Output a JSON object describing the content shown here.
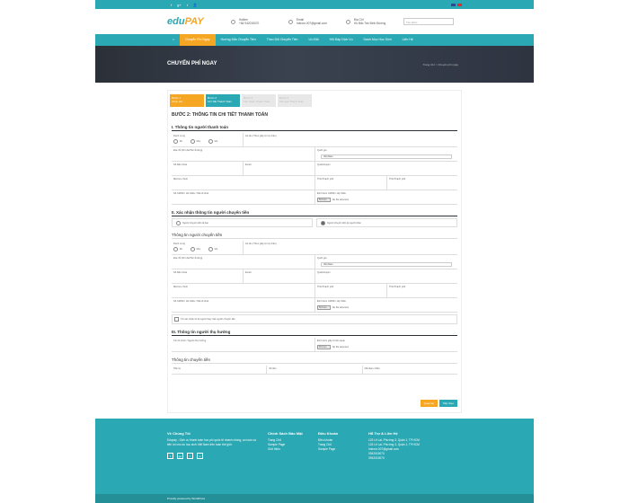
{
  "topbar": {
    "social": [
      "f",
      "g+",
      "t",
      "👤"
    ]
  },
  "header": {
    "logo_main": "edu",
    "logo_accent": "PAY",
    "items": [
      {
        "label": "Hotline",
        "value": "+84 942015070"
      },
      {
        "label": "Email",
        "value": "hotrom.007@gmail.com"
      },
      {
        "label": "Địa Chỉ",
        "value": "Hồ Bắc Tân Bình Đường"
      }
    ],
    "search_placeholder": "Tìm kiếm"
  },
  "nav": {
    "items": [
      "Chuyển Phí Ngay",
      "Hướng Dẫn Chuyển Tiền",
      "Theo Dõi Chuyển Tiền",
      "Ưu Đãi",
      "Hỏi Đáp Dịch Vụ",
      "Danh Mục Học Sinh",
      "Liên Hệ"
    ]
  },
  "hero": {
    "title": "CHUYỂN PHÍ NGAY",
    "breadcrumb": "Trang chủ  >  Chuyển phí ngay"
  },
  "steps": [
    {
      "n": "Bước 1",
      "t": "Chọn phí"
    },
    {
      "n": "Bước 2",
      "t": "Chi Tiết Thanh Toán"
    },
    {
      "n": "Bước 3",
      "t": "Xác nhận Thanh Toán"
    },
    {
      "n": "Bước 4",
      "t": "Kết quả Thanh Toán"
    }
  ],
  "form": {
    "heading": "BƯỚC 2: THÔNG TIN CHI TIẾT THANH TOÁN",
    "sec1": "I. Thông tin người thanh toán",
    "sec2": "II. Xác nhận thông tin người chuyển tiền",
    "sec2_opt1": "Người chuyển tiền là bạn",
    "sec2_opt2": "Người chuyển tiền là người khác",
    "sec2_sub": "Thông tin người chuyển tiền",
    "sec3": "III. Thông tin người thụ hưởng",
    "sec4": "Thông tin chuyển tiền",
    "label_title": "Danh xưng",
    "titles": [
      "Mr.",
      "Mrs.",
      "Ms."
    ],
    "label_name": "Họ tên (Theo giấy tờ tùy thân)",
    "label_address": "Địa chỉ (Số nhà/Tên đường)",
    "label_country": "Quốc gia",
    "country_value": "Việt Nam",
    "label_phone": "Số điện thoại",
    "label_email": "Email",
    "label_city": "Quận/Huyện",
    "label_zip": "Mã bưu chính",
    "label_state": "Tỉnh/Thành phố",
    "label_province": "Tỉnh/Thành phố",
    "label_id": "Số CMND / Hộ chiếu / Mã số thuế",
    "label_upload": "Đính kèm CMND / Hộ chiếu",
    "file_button": "Browse...",
    "file_status": "No file selected.",
    "checkbox": "Tôi xác nhận tôi là người thay mặt người chuyển tiền",
    "beneficiary_name": "Tên tổ chức / Người thụ hưởng",
    "beneficiary_upload": "Đính kèm giấy tờ liên quan",
    "transfer_col1": "Tiền tệ",
    "transfer_col2": "Số tiền",
    "transfer_col3": "Mã tham chiếu",
    "btn_back": "Quay lại",
    "btn_next": "Tiếp theo"
  },
  "footer": {
    "about_title": "Về Chúng Tôi",
    "about_text": "Edupay - Dịch vụ thanh toán học phí quốc tế nhanh chóng, an toàn và tiện lợi cho du học sinh Việt Nam trên toàn thế giới.",
    "col2_title": "Chính Sách Bảo Mật",
    "col2_items": [
      "Trang Chủ",
      "Sample Page",
      "Giới thiệu"
    ],
    "col3_title": "Điều Khoản",
    "col3_items": [
      "Điều khoản",
      "Trang Chủ",
      "Sample Page"
    ],
    "col4_title": "Hỗ Trợ & Liên Hệ",
    "col4_items": [
      "123 Lê Lai, Phường 3, Quận 1, TP.HCM",
      "123 Lê Lai, Phường 3, Quận 1, TP.HCM",
      "hotrom.007@gmail.com",
      "0942015070",
      "0942015070"
    ],
    "copyright": "Proudly powered by WordPress"
  },
  "colors": {
    "teal": "#2aa8b3",
    "orange": "#f5a623",
    "dark": "#2b3038"
  }
}
